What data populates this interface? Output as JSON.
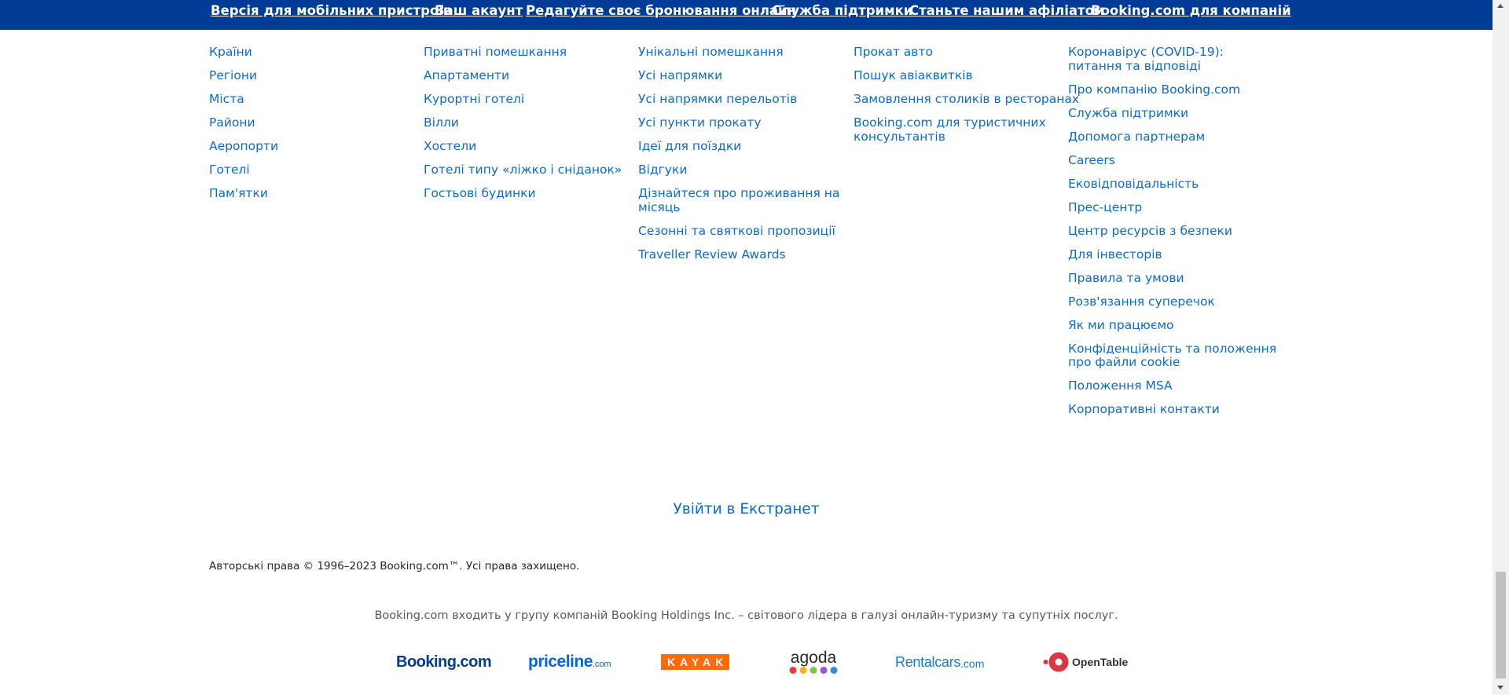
{
  "top_nav": [
    "Версія для мобільних пристроїв",
    "Ваш акаунт",
    "Редагуйте своє бронювання онлайн",
    "Служба підтримки",
    "Станьте нашим афіліатом",
    "Booking.com для компаній"
  ],
  "columns": [
    [
      "Країни",
      "Регіони",
      "Міста",
      "Райони",
      "Аеропорти",
      "Готелі",
      "Пам'ятки"
    ],
    [
      "Приватні помешкання",
      "Апартаменти",
      "Курортні готелі",
      "Вілли",
      "Хостели",
      "Готелі типу «ліжко і сніданок»",
      "Гостьові будинки"
    ],
    [
      "Унікальні помешкання",
      "Усі напрямки",
      "Усі напрямки перельотів",
      "Усі пункти прокату",
      "Ідеї для поїздки",
      "Відгуки",
      "Дізнайтеся про проживання на місяць",
      "Сезонні та святкові пропозиції",
      "Traveller Review Awards"
    ],
    [
      "Прокат авто",
      "Пошук авіаквитків",
      "Замовлення столиків в ресторанах",
      "Booking.com для туристичних консультантів"
    ],
    [
      "Коронавірус (COVID-19): питання та відповіді",
      "Про компанію Booking.com",
      "Служба підтримки",
      "Допомога партнерам",
      "Careers",
      "Ековідповідальність",
      "Прес-центр",
      "Центр ресурсів з безпеки",
      "Для інвесторів",
      "Правила та умови",
      "Розв'язання суперечок",
      "Як ми працюємо",
      "Конфіденційність та положення про файли cookie",
      "Положення MSA",
      "Корпоративні контакти"
    ]
  ],
  "extranet_label": "Увійти в Екстранет",
  "copyright": "Авторські права © 1996–2023 Booking.com™. Усі права захищено.",
  "group_text": "Booking.com входить у групу компаній Booking Holdings Inc. – світового лідера в галузі онлайн-туризму та супутніх послуг.",
  "brands": {
    "booking": "Booking.com",
    "priceline_main": "priceline",
    "priceline_suffix": ".com",
    "kayak": "KAYAK",
    "agoda": "agoda",
    "rentalcars_main": "Rentalcars",
    "rentalcars_suffix": ".com",
    "opentable": "OpenTable"
  },
  "colors": {
    "nav_background": "#003b95",
    "link": "#0c6bcc",
    "booking_logo": "#003b95",
    "priceline_logo": "#0066e4",
    "kayak_logo": "#ff690f",
    "agoda_dots": [
      "#ee3a3a",
      "#fbb21a",
      "#7ac943",
      "#a056c5",
      "#2d8fe3"
    ],
    "rentalcars_logo": "#1879ca",
    "opentable_logo": "#da3743"
  }
}
